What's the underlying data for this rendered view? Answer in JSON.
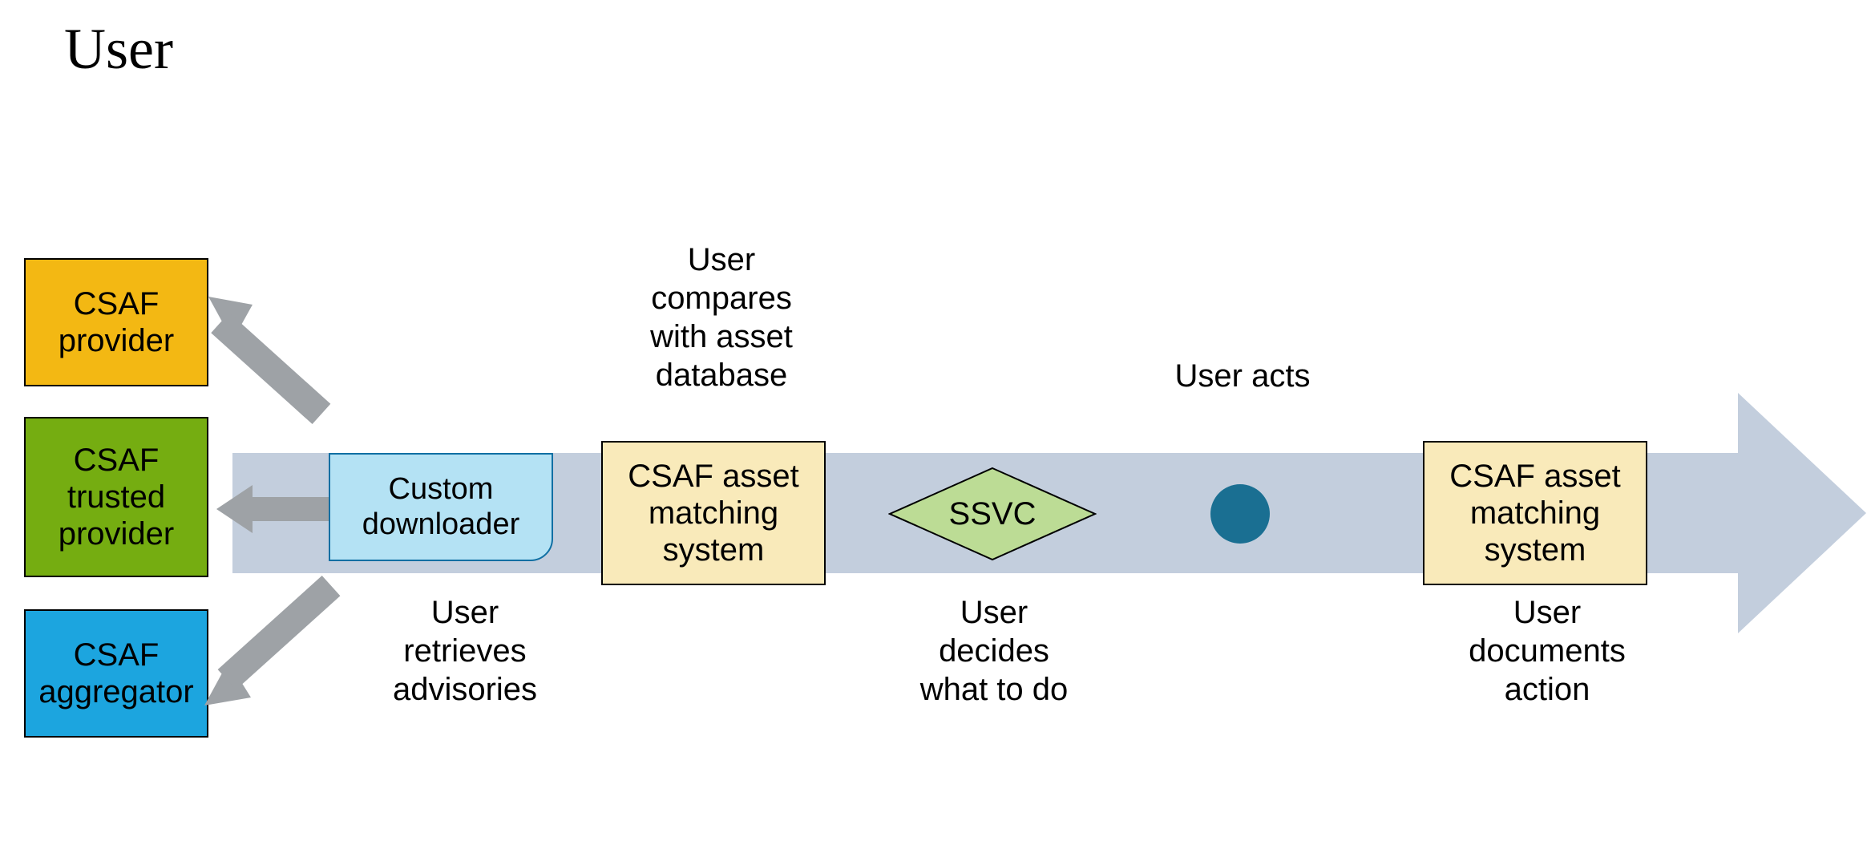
{
  "title": "User",
  "sources": {
    "provider": "CSAF\nprovider",
    "trusted_provider": "CSAF\ntrusted\nprovider",
    "aggregator": "CSAF\naggregator"
  },
  "downloader": "Custom\ndownloader",
  "labels": {
    "retrieve": "User\nretrieves\nadvisories",
    "compare": "User\ncompares\nwith asset\ndatabase",
    "decide": "User\ndecides\nwhat to do",
    "acts": "User acts",
    "documents": "User\ndocuments\naction"
  },
  "nodes": {
    "asset_matching": "CSAF asset\nmatching\nsystem",
    "ssvc": "SSVC",
    "asset_matching2": "CSAF asset\nmatching\nsystem"
  },
  "colors": {
    "orange": "#f3b813",
    "green": "#75ad11",
    "blue": "#1ca5df",
    "lightblue": "#b4e2f4",
    "sand": "#f9eaba",
    "flow": "#c3cedd",
    "arrow": "#9ea2a6",
    "dot": "#1a6f92",
    "diamond": "#bcdc95"
  }
}
